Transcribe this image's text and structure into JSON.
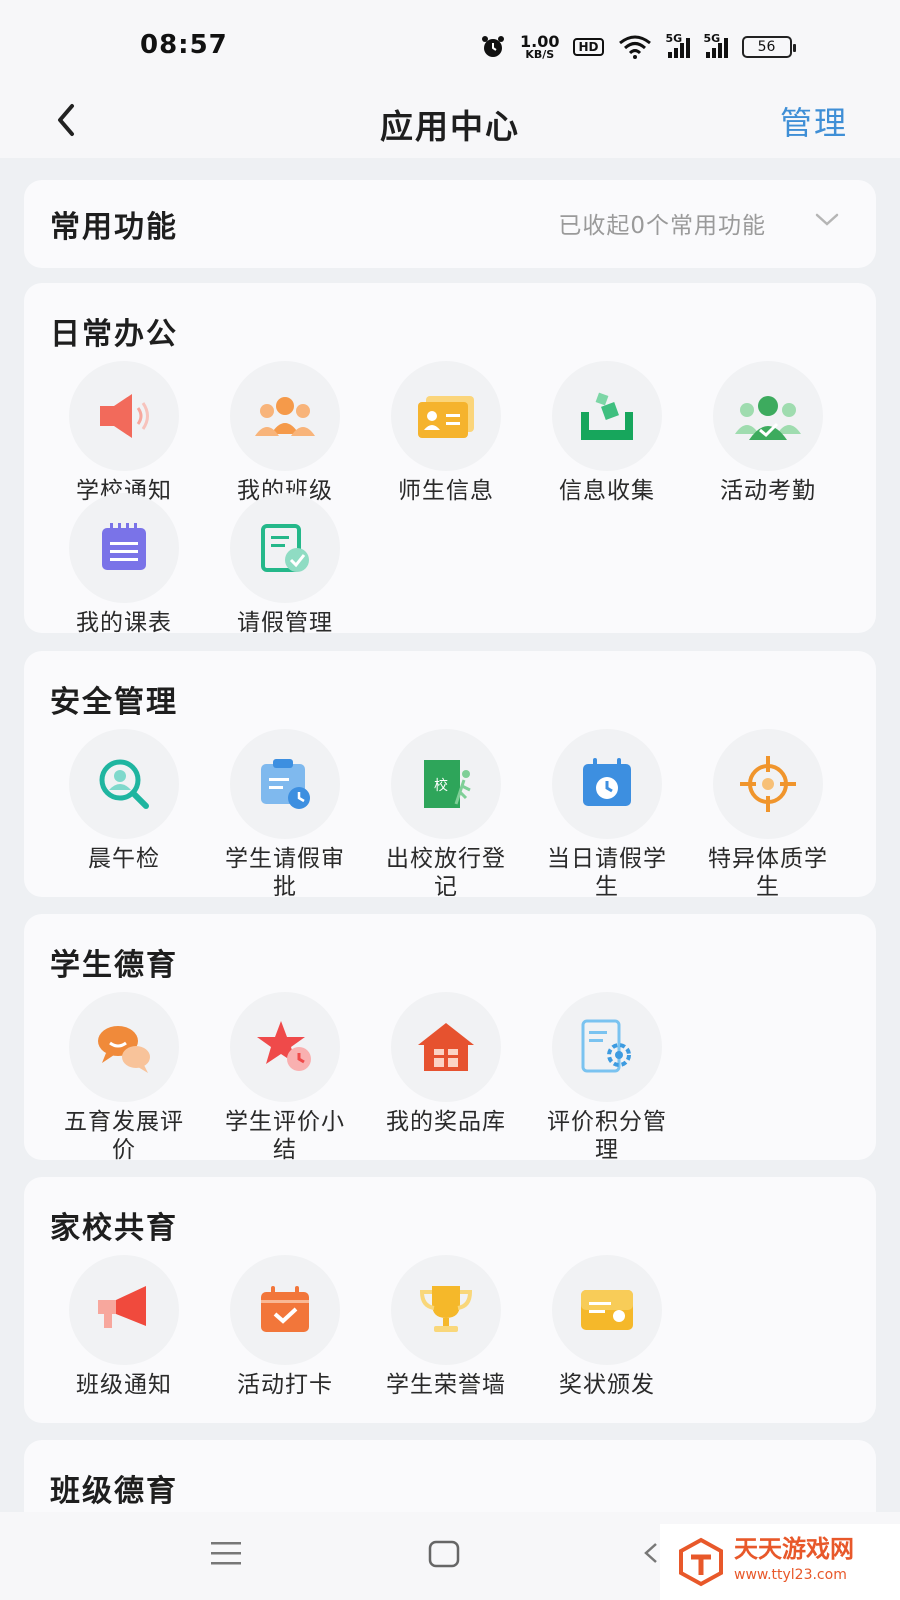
{
  "status_bar": {
    "time": "08:57",
    "net_speed_value": "1.00",
    "net_speed_unit": "KB/S",
    "hd_label": "HD",
    "sim1_label": "5G",
    "sim2_label": "5G",
    "battery": "56"
  },
  "header": {
    "title": "应用中心",
    "manage_label": "管理"
  },
  "frequent": {
    "title": "常用功能",
    "collapsed_hint": "已收起0个常用功能"
  },
  "sections": [
    {
      "title": "日常办公",
      "apps": [
        {
          "label": "学校通知",
          "icon": "speaker-icon"
        },
        {
          "label": "我的班级",
          "icon": "group-icon"
        },
        {
          "label": "师生信息",
          "icon": "id-card-icon"
        },
        {
          "label": "信息收集",
          "icon": "collect-box-icon"
        },
        {
          "label": "活动考勤",
          "icon": "attendance-icon"
        },
        {
          "label": "我的课表",
          "icon": "schedule-icon"
        },
        {
          "label": "请假管理",
          "icon": "leave-form-icon"
        }
      ]
    },
    {
      "title": "安全管理",
      "apps": [
        {
          "label": "晨午检",
          "icon": "health-check-icon"
        },
        {
          "label": "学生请假审批",
          "icon": "leave-approval-icon"
        },
        {
          "label": "出校放行登记",
          "icon": "exit-door-icon"
        },
        {
          "label": "当日请假学生",
          "icon": "calendar-clock-icon"
        },
        {
          "label": "特异体质学生",
          "icon": "target-icon"
        }
      ]
    },
    {
      "title": "学生德育",
      "apps": [
        {
          "label": "五育发展评价",
          "icon": "chat-bubbles-icon"
        },
        {
          "label": "学生评价小结",
          "icon": "star-clock-icon"
        },
        {
          "label": "我的奖品库",
          "icon": "gift-house-icon"
        },
        {
          "label": "评价积分管理",
          "icon": "settings-doc-icon"
        }
      ]
    },
    {
      "title": "家校共育",
      "apps": [
        {
          "label": "班级通知",
          "icon": "megaphone-icon"
        },
        {
          "label": "活动打卡",
          "icon": "checkin-calendar-icon"
        },
        {
          "label": "学生荣誉墙",
          "icon": "trophy-icon"
        },
        {
          "label": "奖状颁发",
          "icon": "certificate-icon"
        }
      ]
    },
    {
      "title": "班级德育",
      "apps": []
    }
  ],
  "watermark": {
    "name": "天天游戏网",
    "url": "www.ttyl23.com"
  }
}
